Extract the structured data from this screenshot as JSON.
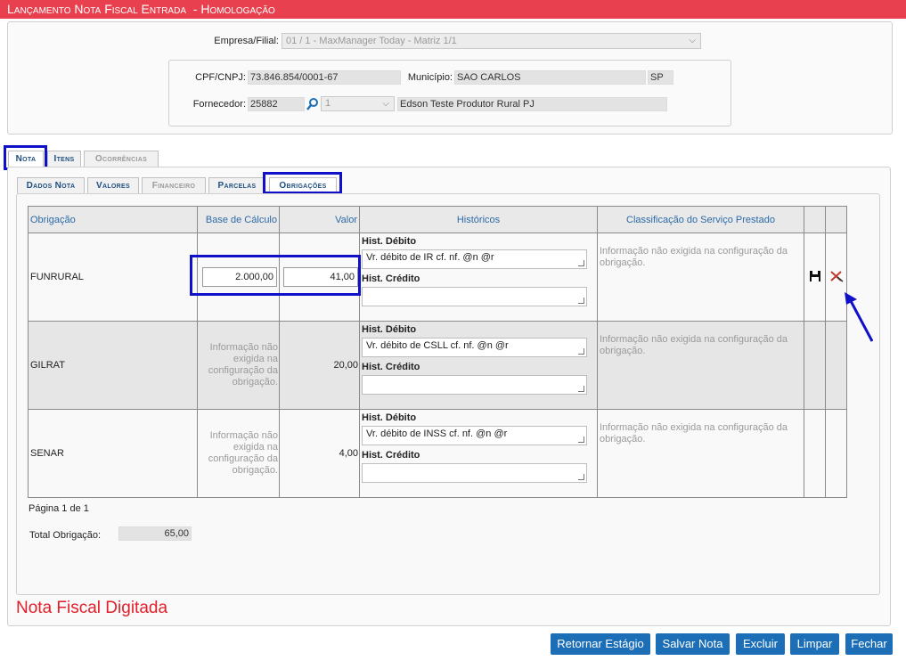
{
  "window": {
    "title": "Lançamento Nota Fiscal Entrada",
    "environment": "- Homologação"
  },
  "header": {
    "empresa_label": "Empresa/Filial:",
    "empresa_value": "01 / 1 - MaxManager Today - Matriz 1/1",
    "cpf_label": "CPF/CNPJ:",
    "cpf_value": "73.846.854/0001-67",
    "municipio_label": "Município:",
    "municipio_value": "SAO CARLOS",
    "uf_value": "SP",
    "fornecedor_label": "Fornecedor:",
    "fornecedor_code": "25882",
    "fornecedor_seq": "1",
    "fornecedor_name": "Edson Teste Produtor Rural PJ"
  },
  "main_tabs": [
    {
      "label": "Nota",
      "state": "active"
    },
    {
      "label": "Itens",
      "state": "normal"
    },
    {
      "label": "Ocorrências",
      "state": "disabled"
    }
  ],
  "sub_tabs": [
    {
      "label": "Dados Nota",
      "state": "normal"
    },
    {
      "label": "Valores",
      "state": "normal"
    },
    {
      "label": "Financeiro",
      "state": "disabled"
    },
    {
      "label": "Parcelas",
      "state": "normal"
    },
    {
      "label": "Obrigações",
      "state": "active"
    }
  ],
  "grid": {
    "columns": [
      "Obrigação",
      "Base de Cálculo",
      "Valor",
      "Históricos",
      "Classificação do Serviço Prestado"
    ],
    "hist_debit_label": "Hist. Débito",
    "hist_credit_label": "Hist. Crédito",
    "rows": [
      {
        "obrigacao": "FUNRURAL",
        "base": "2.000,00",
        "valor": "41,00",
        "hist_debito": "Vr. débito de IR cf. nf. @n @r",
        "hist_credito": "",
        "classificacao": "Informação não exigida na configuração da obrigação.",
        "editing": true
      },
      {
        "obrigacao": "GILRAT",
        "base": "Informação não exigida na configuração da obrigação.",
        "valor": "20,00",
        "hist_debito": "Vr. débito de CSLL cf. nf. @n @r",
        "hist_credito": "",
        "classificacao": "Informação não exigida na configuração da obrigação.",
        "editing": false
      },
      {
        "obrigacao": "SENAR",
        "base": "Informação não exigida na configuração da obrigação.",
        "valor": "4,00",
        "hist_debito": "Vr. débito de INSS cf. nf. @n @r",
        "hist_credito": "",
        "classificacao": "Informação não exigida na configuração da obrigação.",
        "editing": false
      }
    ]
  },
  "pagination": "Página 1 de 1",
  "total": {
    "label": "Total Obrigação:",
    "value": "65,00"
  },
  "status_text": "Nota Fiscal Digitada",
  "buttons": [
    "Retornar Estágio",
    "Salvar Nota",
    "Excluir",
    "Limpar",
    "Fechar"
  ],
  "colors": {
    "titlebar": "#e8404e",
    "primary_button": "#1c6fb6",
    "status_text": "#e0202a",
    "highlight": "#1010c8"
  },
  "icons": {
    "save": "save-icon",
    "cancel": "cancel-edit-icon",
    "lookup": "search-icon"
  }
}
